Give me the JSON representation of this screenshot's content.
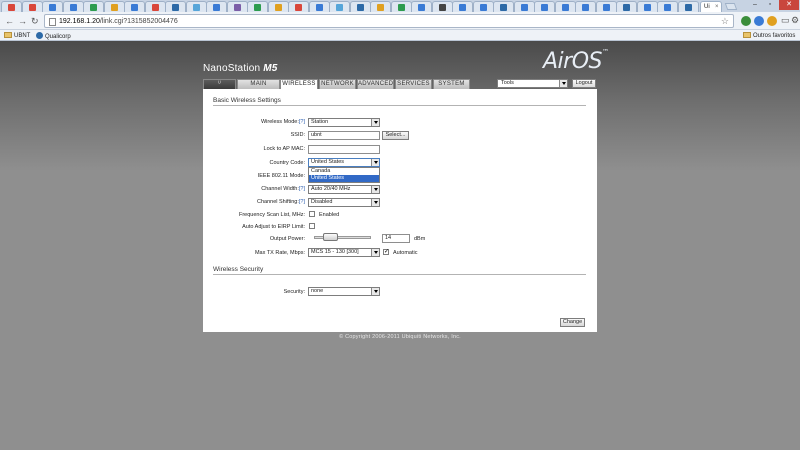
{
  "browser": {
    "tab_title": "Ui",
    "url_host": "192.168.1.20",
    "url_path": "/link.cgi?1315852004476",
    "bookmarks": [
      "UBNT",
      "Qualicorp"
    ],
    "other_bookmarks": "Outros favoritos",
    "tab_favicon_colors": [
      "#d9473b",
      "#d9473b",
      "#3a7bd5",
      "#3a7bd5",
      "#2d9c4f",
      "#e0a020",
      "#3a7bd5",
      "#d9473b",
      "#2d6aa7",
      "#56a5d9",
      "#3a7bd5",
      "#7b5ea7",
      "#2d9c4f",
      "#e0a020",
      "#d9473b",
      "#3a7bd5",
      "#56a5d9",
      "#2d6aa7",
      "#e0a020",
      "#2d9c4f",
      "#3a7bd5",
      "#444",
      "#3a7bd5",
      "#3a7bd5",
      "#2d6aa7",
      "#3a7bd5",
      "#3a7bd5",
      "#3a7bd5",
      "#3a7bd5",
      "#3a7bd5",
      "#2d6aa7",
      "#3a7bd5",
      "#3a7bd5",
      "#2d6aa7"
    ]
  },
  "header": {
    "device_name": "NanoStation",
    "device_model": "M5",
    "logo": "AirOS",
    "tabs": [
      "MAIN",
      "WIRELESS",
      "NETWORK",
      "ADVANCED",
      "SERVICES",
      "SYSTEM"
    ],
    "active_tab": "WIRELESS",
    "tools": "Tools",
    "logout": "Logout"
  },
  "basic": {
    "section_title": "Basic Wireless Settings",
    "wireless_mode_label": "Wireless Mode:",
    "wireless_mode": "Station",
    "ssid_label": "SSID:",
    "ssid": "ubnt",
    "select_button": "Select...",
    "lock_ap_label": "Lock to AP MAC:",
    "lock_ap": "",
    "country_label": "Country Code:",
    "country": "United States",
    "country_options": [
      "Canada",
      "United States"
    ],
    "ieee_label": "IEEE 802.11 Mode:",
    "channel_width_label": "Channel Width:",
    "channel_width": "Auto 20/40 MHz",
    "channel_shifting_label": "Channel Shifting:",
    "channel_shifting": "Disabled",
    "freq_scan_label": "Frequency Scan List, MHz:",
    "enabled_label": "Enabled",
    "auto_adjust_label": "Auto Adjust to EIRP Limit:",
    "output_power_label": "Output Power:",
    "output_power": "14",
    "output_power_unit": "dBm",
    "max_tx_label": "Max TX Rate, Mbps:",
    "max_tx": "MCS 15 - 130 [300]",
    "automatic_label": "Automatic",
    "help_mark": "[?]"
  },
  "security": {
    "section_title": "Wireless Security",
    "security_label": "Security:",
    "security": "none"
  },
  "actions": {
    "change": "Change"
  },
  "footer": {
    "copyright": "© Copyright 2006-2011 Ubiquiti Networks, Inc."
  }
}
